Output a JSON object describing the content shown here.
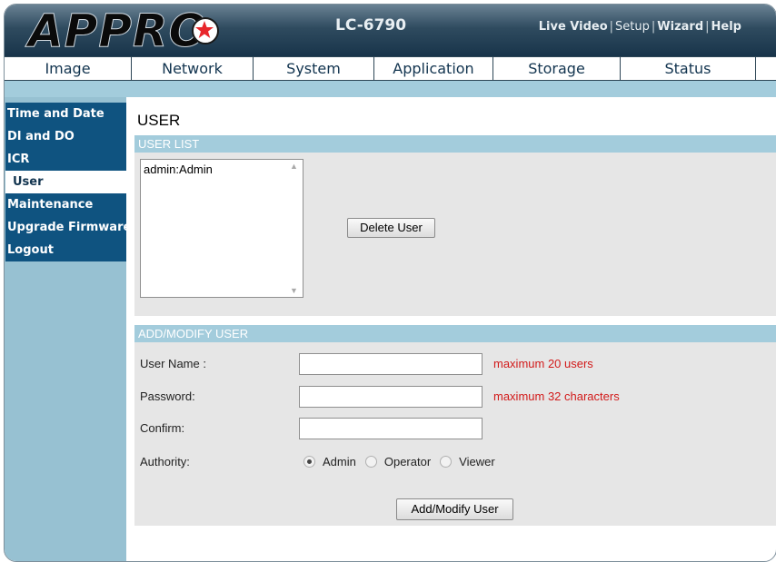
{
  "header": {
    "logo": "APPRO",
    "model": "LC-6790",
    "links": [
      "Live Video",
      "Setup",
      "Wizard",
      "Help"
    ]
  },
  "tabs": [
    "Image",
    "Network",
    "System",
    "Application",
    "Storage",
    "Status"
  ],
  "sidebar": {
    "items": [
      "Time and Date",
      "DI and DO",
      "ICR",
      "User",
      "Maintenance",
      "Upgrade Firmware",
      "Logout"
    ],
    "active": "User"
  },
  "page": {
    "title": "USER",
    "user_list": {
      "header": "USER LIST",
      "items": [
        "admin:Admin"
      ],
      "delete_button": "Delete User"
    },
    "add_modify": {
      "header": "ADD/MODIFY USER",
      "username_label": "User Name :",
      "username_value": "",
      "username_hint": "maximum 20 users",
      "password_label": "Password:",
      "password_value": "",
      "password_hint": "maximum 32 characters",
      "confirm_label": "Confirm:",
      "confirm_value": "",
      "authority_label": "Authority:",
      "authority_options": [
        "Admin",
        "Operator",
        "Viewer"
      ],
      "authority_selected": "Admin",
      "submit_button": "Add/Modify User"
    }
  },
  "colors": {
    "header_dark": "#18344a",
    "nav_text": "#12344f",
    "sidebar_bg": "#97c1d2",
    "menu_bg": "#0f5380",
    "section_bg": "#a3ccdc",
    "panel_bg": "#e6e6e6",
    "hint": "#d21a1a"
  },
  "icons": {
    "logo_star": "red-star-icon"
  }
}
